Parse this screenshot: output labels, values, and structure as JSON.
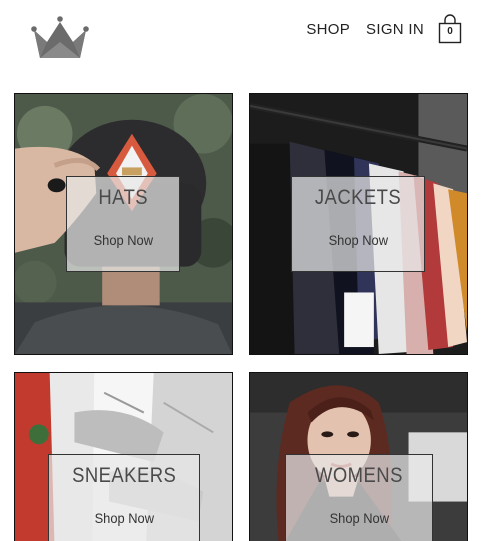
{
  "header": {
    "logo_icon": "crown-icon",
    "nav": [
      {
        "label": "SHOP"
      },
      {
        "label": "SIGN IN"
      }
    ],
    "cart": {
      "icon": "shopping-bag-icon",
      "count": "0"
    }
  },
  "categories": [
    {
      "title": "HATS",
      "cta": "Shop Now"
    },
    {
      "title": "JACKETS",
      "cta": "Shop Now"
    },
    {
      "title": "SNEAKERS",
      "cta": "Shop Now"
    },
    {
      "title": "WOMENS",
      "cta": "Shop Now"
    }
  ],
  "colors": {
    "logo": "#6b6b6b",
    "text": "#222222",
    "overlay": "#e8e8e8"
  }
}
